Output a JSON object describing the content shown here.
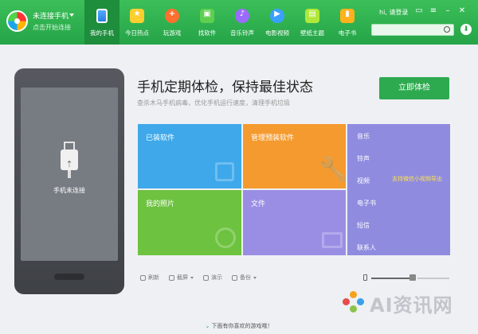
{
  "header": {
    "connection_title": "未连接手机",
    "connection_sub": "点击开始连接",
    "nav": [
      {
        "label": "我的手机",
        "icon": "phone-icon",
        "active": true
      },
      {
        "label": "今日热点",
        "icon": "hot-icon"
      },
      {
        "label": "玩游戏",
        "icon": "gamepad-icon"
      },
      {
        "label": "找软件",
        "icon": "android-icon"
      },
      {
        "label": "音乐铃声",
        "icon": "music-icon"
      },
      {
        "label": "电影视频",
        "icon": "play-icon"
      },
      {
        "label": "壁纸主题",
        "icon": "wallpaper-icon"
      },
      {
        "label": "电子书",
        "icon": "book-icon"
      }
    ],
    "user": "hi, 请登录",
    "search_placeholder": ""
  },
  "phone": {
    "status": "手机未连接"
  },
  "main": {
    "headline": "手机定期体检，保持最佳状态",
    "subline": "查杀木马手机病毒，优化手机运行速度，清理手机垃圾",
    "check_button": "立即体检",
    "tiles": {
      "installed": "已装软件",
      "preinstalled": "管理预装软件",
      "photos": "我的照片",
      "files": "文件"
    },
    "side_list": [
      "音乐",
      "铃声",
      "视频",
      "电子书",
      "短信",
      "联系人"
    ],
    "side_note": "支持微信小视频导出",
    "toolbar": [
      {
        "label": "刷新",
        "icon": "refresh-icon"
      },
      {
        "label": "截屏",
        "icon": "screenshot-icon",
        "dropdown": true
      },
      {
        "label": "演示",
        "icon": "present-icon"
      },
      {
        "label": "备份",
        "icon": "cloud-icon",
        "dropdown": true
      }
    ]
  },
  "footer": {
    "more_games": "下面有你喜欢的游戏哦！"
  },
  "watermark": {
    "text": "AI资讯网"
  },
  "colors": {
    "accent": "#2daa4f",
    "tile_blue": "#3ea8ea",
    "tile_orange": "#f59a2e",
    "tile_green": "#6dc23f",
    "tile_purple": "#9a8ee4"
  }
}
